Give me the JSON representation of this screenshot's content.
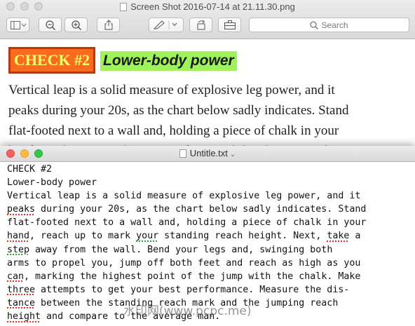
{
  "preview": {
    "window_title": "Screen Shot 2016-07-14 at 21.11.30.png",
    "search_placeholder": "Search",
    "toolbar_icons": [
      "sidebar-icon",
      "zoom-out-icon",
      "zoom-in-icon",
      "share-icon",
      "markup-pen-icon",
      "rotate-icon",
      "toolbox-icon",
      "search-icon"
    ],
    "heading_badge": "CHECK #2",
    "heading_title": "Lower-body power",
    "body_lines": [
      "Vertical leap is a solid measure of explosive leg power, and it",
      "peaks during your 20s, as the chart below sadly indicates. Stand",
      "flat-footed next to a wall and, holding a piece of chalk in your",
      "hand, reach up to mark your standing reach height. Next, take a"
    ],
    "colors": {
      "badge_bg": "#fb6b1e",
      "badge_border": "#b83a0c",
      "badge_text": "#f6ff6b",
      "title_highlight": "#9ef25a"
    }
  },
  "textedit": {
    "window_title": "Untitle.txt",
    "lines": [
      {
        "parts": [
          {
            "t": "CHECK #2"
          }
        ]
      },
      {
        "parts": [
          {
            "t": "Lower-body power"
          }
        ]
      },
      {
        "parts": [
          {
            "t": "Vertical leap is a solid measure of explosive leg power, and it"
          }
        ]
      },
      {
        "parts": [
          {
            "t": "peaks",
            "u": "sp"
          },
          {
            "t": " during your 20s, as the chart below sadly indicates. Stand"
          }
        ]
      },
      {
        "parts": [
          {
            "t": "flat-footed next to a wall and, holding a piece of chalk in your"
          }
        ]
      },
      {
        "parts": [
          {
            "t": "hand",
            "u": "sp"
          },
          {
            "t": ", reach up to mark "
          },
          {
            "t": "your",
            "u": "gr"
          },
          {
            "t": " standing reach height. Next, "
          },
          {
            "t": "take",
            "u": "sp"
          },
          {
            "t": " a"
          }
        ]
      },
      {
        "parts": [
          {
            "t": "step",
            "u": "gr"
          },
          {
            "t": " away from the wall. Bend your legs and, swinging both"
          }
        ]
      },
      {
        "parts": [
          {
            "t": "arms to propel you, jump off both feet and reach as high as you"
          }
        ]
      },
      {
        "parts": [
          {
            "t": "can",
            "u": "sp"
          },
          {
            "t": ", marking the highest point of the jump with the chalk. Make"
          }
        ]
      },
      {
        "parts": [
          {
            "t": "three",
            "u": "sp"
          },
          {
            "t": " attempts to get your best performance. Measure the dis-"
          }
        ]
      },
      {
        "parts": [
          {
            "t": "tance",
            "u": "sp"
          },
          {
            "t": " between the standing reach mark and the jumping reach"
          }
        ]
      },
      {
        "parts": [
          {
            "t": "height",
            "u": "sp"
          },
          {
            "t": " and compare to the average man."
          }
        ]
      }
    ]
  },
  "watermark": "水印网(www.pcpc.me)"
}
